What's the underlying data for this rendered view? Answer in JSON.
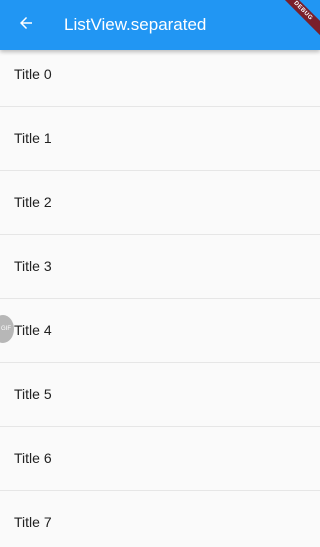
{
  "appbar": {
    "title": "ListView.separated",
    "back_icon": "arrow-back-icon",
    "background": "#2196f3"
  },
  "debug_banner": {
    "label": "DEBUG"
  },
  "side_handle": {
    "label": "GIF"
  },
  "list": {
    "items": [
      {
        "label": "Title 0"
      },
      {
        "label": "Title 1"
      },
      {
        "label": "Title 2"
      },
      {
        "label": "Title 3"
      },
      {
        "label": "Title 4"
      },
      {
        "label": "Title 5"
      },
      {
        "label": "Title 6"
      },
      {
        "label": "Title 7"
      }
    ]
  }
}
